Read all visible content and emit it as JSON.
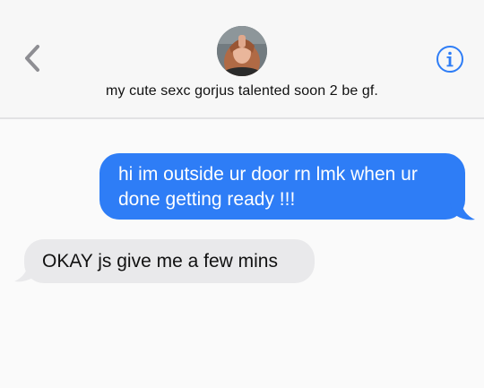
{
  "header": {
    "contact_name": "my cute sexc gorjus talented soon 2 be gf.",
    "back_icon": "chevron-left-icon",
    "info_icon": "info-icon"
  },
  "colors": {
    "accent": "#2e7df6",
    "incoming_bubble": "#e9e9eb",
    "background": "#fafafa"
  },
  "messages": [
    {
      "direction": "outgoing",
      "text": "hi im outside ur door rn lmk when ur done getting ready !!!"
    },
    {
      "direction": "incoming",
      "text": "OKAY js give me a few mins"
    }
  ]
}
